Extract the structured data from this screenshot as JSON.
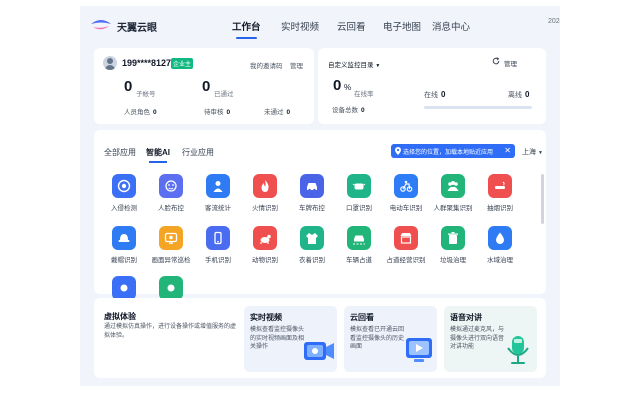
{
  "nav": {
    "brand": "天翼云眼",
    "tabs": [
      {
        "label": "工作台",
        "active": true
      },
      {
        "label": "实时视频",
        "active": false
      },
      {
        "label": "云回看",
        "active": false
      },
      {
        "label": "电子地图",
        "active": false
      },
      {
        "label": "消息中心",
        "active": false
      }
    ],
    "date": "2024"
  },
  "account": {
    "phone": "199****8127",
    "badge": "企业主",
    "invite_link": "我的邀请码",
    "manage_link": "管理",
    "sub_accounts": {
      "value": "0",
      "unit": "子帐号"
    },
    "passed": {
      "value": "0",
      "unit": "已通过"
    },
    "roles": {
      "label": "人员角色",
      "value": "0"
    },
    "pending": {
      "label": "待审核",
      "value": "0"
    },
    "rejected": {
      "label": "未通过",
      "value": "0"
    }
  },
  "monitor": {
    "dropdown": "自定义监控目录",
    "manage": "管理",
    "online_rate": {
      "value": "0",
      "sign": "%",
      "unit": "在线率"
    },
    "device_total": {
      "label": "设备总数",
      "value": "0"
    },
    "online": {
      "label": "在线",
      "value": "0"
    },
    "offline": {
      "label": "离线",
      "value": "0"
    },
    "online_fraction": 0
  },
  "apps": {
    "tabs": [
      {
        "label": "全部应用",
        "active": false
      },
      {
        "label": "智能AI",
        "active": true
      },
      {
        "label": "行业应用",
        "active": false
      }
    ],
    "location_tip": "选择您的位置，加载本地贴近应用",
    "city": "上海",
    "tiles": [
      {
        "label": "入侵检测",
        "color": "#3b6ff5",
        "icon": "target-icon"
      },
      {
        "label": "人脸布控",
        "color": "#5b6ff0",
        "icon": "face-icon"
      },
      {
        "label": "客流统计",
        "color": "#2f7bf4",
        "icon": "people-count-icon"
      },
      {
        "label": "火情识别",
        "color": "#f04f4f",
        "icon": "fire-icon"
      },
      {
        "label": "车牌布控",
        "color": "#4a64e8",
        "icon": "car-icon"
      },
      {
        "label": "口罩识别",
        "color": "#1fb589",
        "icon": "mask-icon"
      },
      {
        "label": "电动车识别",
        "color": "#2e7cf6",
        "icon": "ebike-icon"
      },
      {
        "label": "人群聚集识别",
        "color": "#22b57a",
        "icon": "crowd-icon"
      },
      {
        "label": "抽烟识别",
        "color": "#ef4f4f",
        "icon": "smoking-icon"
      },
      {
        "label": "戴帽识别",
        "color": "#2f7bf4",
        "icon": "hat-icon"
      },
      {
        "label": "画面异常巡检",
        "color": "#f5a524",
        "icon": "screen-check-icon"
      },
      {
        "label": "手机识别",
        "color": "#4a6cf0",
        "icon": "phone-icon"
      },
      {
        "label": "动物识别",
        "color": "#f04f4f",
        "icon": "animal-icon"
      },
      {
        "label": "衣着识别",
        "color": "#1fb589",
        "icon": "clothes-icon"
      },
      {
        "label": "车辆占道",
        "color": "#22b57a",
        "icon": "vehicle-lane-icon"
      },
      {
        "label": "占道经营识别",
        "color": "#f04f4f",
        "icon": "street-stall-icon"
      },
      {
        "label": "垃圾治理",
        "color": "#22b57a",
        "icon": "trash-icon"
      },
      {
        "label": "水域治理",
        "color": "#2f7bf4",
        "icon": "water-icon"
      },
      {
        "label": "",
        "color": "#3b6ff5",
        "icon": "more-app-icon"
      },
      {
        "label": "",
        "color": "#22b57a",
        "icon": "more-app-icon"
      }
    ]
  },
  "promo": {
    "title": "虚拟体验",
    "desc": "通过模拟仿真操作，进行设备操作或增值服务的虚拟体验。",
    "cards": [
      {
        "title": "实时视频",
        "desc": "模拟查看监控摄像头的实时视频画面及相关操作",
        "bg": "#eef2fb"
      },
      {
        "title": "云回看",
        "desc": "模拟查看已开通云回看监控摄像头的历史画面",
        "bg": "#eef2fb"
      },
      {
        "title": "语音对讲",
        "desc": "模拟通过麦克风，与摄像头进行双向语音对讲功能",
        "bg": "#edf6f4"
      }
    ]
  }
}
